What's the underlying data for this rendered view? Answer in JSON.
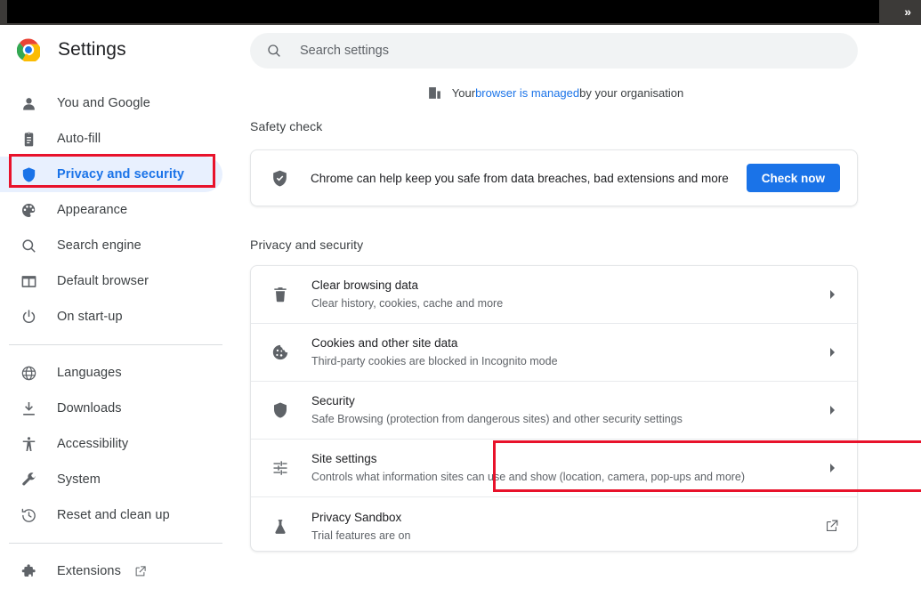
{
  "window": {
    "overflow_label": "»"
  },
  "brand": {
    "title": "Settings",
    "logo_icon": "chrome-logo"
  },
  "search": {
    "placeholder": "Search settings",
    "value": "",
    "icon": "search-icon"
  },
  "managed_banner": {
    "icon": "building-icon",
    "prefix": "Your ",
    "link": "browser is managed",
    "suffix": " by your organisation"
  },
  "sidebar": {
    "groups": [
      {
        "items": [
          {
            "label": "You and Google",
            "icon": "person-icon",
            "selected": false,
            "external": false
          },
          {
            "label": "Auto-fill",
            "icon": "clipboard-icon",
            "selected": false,
            "external": false
          },
          {
            "label": "Privacy and security",
            "icon": "shield-icon",
            "selected": true,
            "external": false
          },
          {
            "label": "Appearance",
            "icon": "palette-icon",
            "selected": false,
            "external": false
          },
          {
            "label": "Search engine",
            "icon": "search-icon",
            "selected": false,
            "external": false
          },
          {
            "label": "Default browser",
            "icon": "browser-icon",
            "selected": false,
            "external": false
          },
          {
            "label": "On start-up",
            "icon": "power-icon",
            "selected": false,
            "external": false
          }
        ]
      },
      {
        "items": [
          {
            "label": "Languages",
            "icon": "globe-icon",
            "selected": false,
            "external": false
          },
          {
            "label": "Downloads",
            "icon": "download-icon",
            "selected": false,
            "external": false
          },
          {
            "label": "Accessibility",
            "icon": "accessibility-icon",
            "selected": false,
            "external": false
          },
          {
            "label": "System",
            "icon": "wrench-icon",
            "selected": false,
            "external": false
          },
          {
            "label": "Reset and clean up",
            "icon": "history-icon",
            "selected": false,
            "external": false
          }
        ]
      },
      {
        "items": [
          {
            "label": "Extensions",
            "icon": "puzzle-icon",
            "selected": false,
            "external": true
          }
        ]
      }
    ]
  },
  "main": {
    "safety_check": {
      "section_title": "Safety check",
      "icon": "shield-check-icon",
      "text": "Chrome can help keep you safe from data breaches, bad extensions and more",
      "button_label": "Check now"
    },
    "privacy": {
      "section_title": "Privacy and security",
      "rows": [
        {
          "title": "Clear browsing data",
          "subtitle": "Clear history, cookies, cache and more",
          "icon": "trash-icon",
          "trailing": "chevron-right-icon",
          "highlighted": false
        },
        {
          "title": "Cookies and other site data",
          "subtitle": "Third-party cookies are blocked in Incognito mode",
          "icon": "cookie-icon",
          "trailing": "chevron-right-icon",
          "highlighted": false
        },
        {
          "title": "Security",
          "subtitle": "Safe Browsing (protection from dangerous sites) and other security settings",
          "icon": "shield-icon",
          "trailing": "chevron-right-icon",
          "highlighted": false
        },
        {
          "title": "Site settings",
          "subtitle": "Controls what information sites can use and show (location, camera, pop-ups and more)",
          "icon": "tune-icon",
          "trailing": "chevron-right-icon",
          "highlighted": true
        },
        {
          "title": "Privacy Sandbox",
          "subtitle": "Trial features are on",
          "icon": "flask-icon",
          "trailing": "external-link-icon",
          "highlighted": false
        }
      ]
    }
  },
  "colors": {
    "accent_blue": "#1a73e8",
    "selected_pill": "#e8f0fe",
    "annotation_red": "#e8122b",
    "text_primary": "#202124",
    "text_secondary": "#5f6368",
    "search_bg": "#f1f3f4",
    "window_bar": "#3c3a38"
  }
}
